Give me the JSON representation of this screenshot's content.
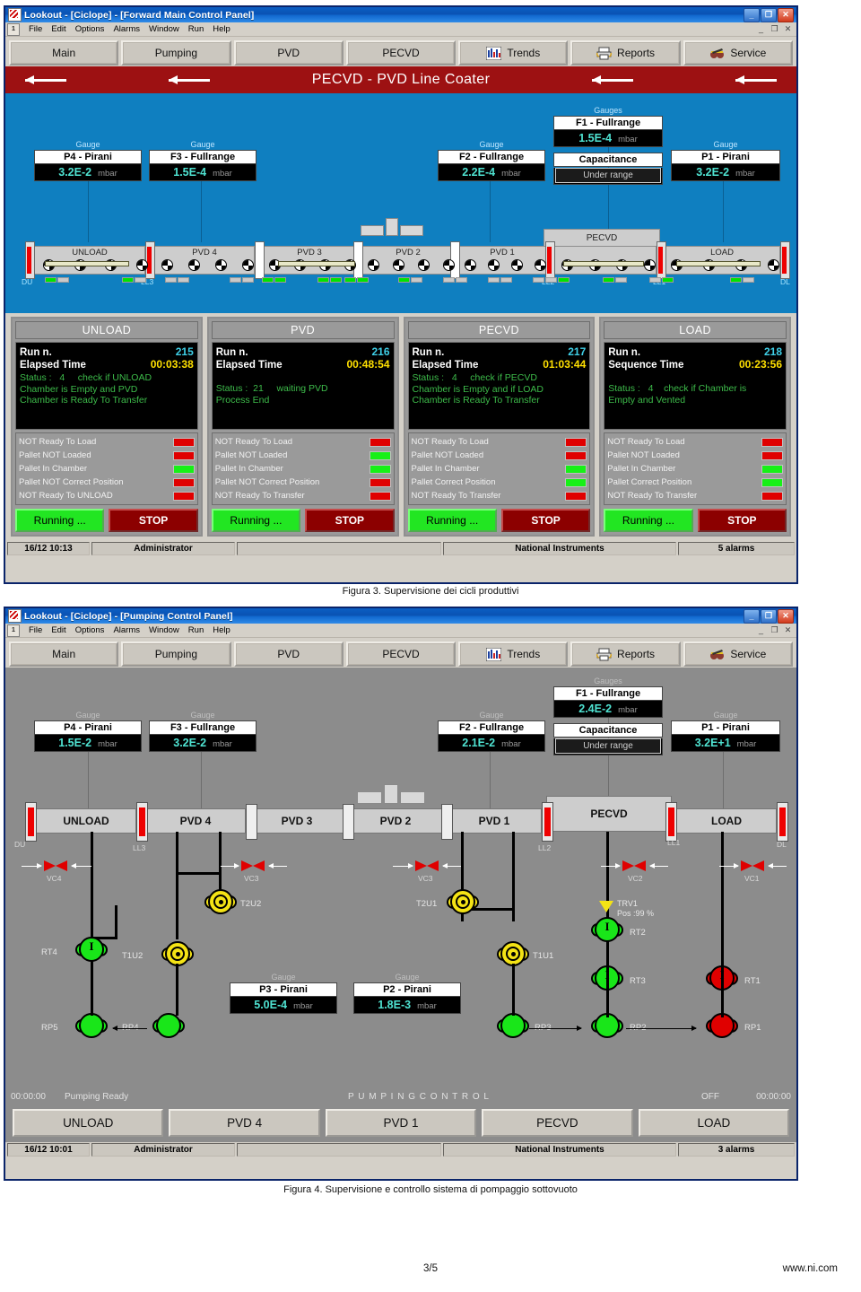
{
  "window1": {
    "title": "Lookout - [Ciclope] - [Forward Main Control Panel]",
    "menu": [
      "File",
      "Edit",
      "Options",
      "Alarms",
      "Window",
      "Run",
      "Help"
    ],
    "toolbar": [
      {
        "label": "Main",
        "icon": ""
      },
      {
        "label": "Pumping",
        "icon": ""
      },
      {
        "label": "PVD",
        "icon": ""
      },
      {
        "label": "PECVD",
        "icon": ""
      },
      {
        "label": "Trends",
        "icon": "bar-chart-icon"
      },
      {
        "label": "Reports",
        "icon": "printer-icon"
      },
      {
        "label": "Service",
        "icon": "tools-icon"
      }
    ],
    "banner": "PECVD - PVD  Line Coater",
    "gauges": [
      {
        "cap": "Gauge",
        "name": "P4 - Pirani",
        "value": "3.2E-2",
        "unit": "mbar"
      },
      {
        "cap": "Gauge",
        "name": "F3 - Fullrange",
        "value": "1.5E-4",
        "unit": "mbar"
      },
      {
        "cap": "Gauge",
        "name": "F2 - Fullrange",
        "value": "2.2E-4",
        "unit": "mbar"
      },
      {
        "cap": "Gauges",
        "name": "F1 - Fullrange",
        "value": "1.5E-4",
        "unit": "mbar"
      },
      {
        "cap": "",
        "name": "Capacitance",
        "value": "Under range",
        "unit": ""
      },
      {
        "cap": "Gauge",
        "name": "P1 - Pirani",
        "value": "3.2E-2",
        "unit": "mbar"
      }
    ],
    "chambers": [
      "UNLOAD",
      "PVD 4",
      "PVD 3",
      "PVD 2",
      "PVD 1",
      "PECVD",
      "LOAD"
    ],
    "gate_labels": [
      "DU",
      "LL3",
      "LL2",
      "LL1",
      "DL"
    ],
    "panels": [
      {
        "title": "UNLOAD",
        "k1": "Run n.",
        "v1": "215",
        "k2": "Elapsed Time",
        "v2": "00:03:38",
        "status": "Status :   4     check if UNLOAD\nChamber is Empty and PVD\nChamber is Ready To Transfer",
        "leds": [
          {
            "label": "NOT Ready To Load",
            "state": "red"
          },
          {
            "label": "Pallet NOT Loaded",
            "state": "red"
          },
          {
            "label": "Pallet In Chamber",
            "state": "green"
          },
          {
            "label": "Pallet NOT Correct Position",
            "state": "red"
          },
          {
            "label": "NOT Ready To UNLOAD",
            "state": "red"
          }
        ],
        "run_label": "Running ...",
        "stop_label": "STOP"
      },
      {
        "title": "PVD",
        "k1": "Run n.",
        "v1": "216",
        "k2": "Elapsed Time",
        "v2": "00:48:54",
        "status": "Status :  21     waiting PVD\nProcess End",
        "leds": [
          {
            "label": "NOT Ready To Load",
            "state": "red"
          },
          {
            "label": "Pallet NOT Loaded",
            "state": "green"
          },
          {
            "label": "Pallet In Chamber",
            "state": "green"
          },
          {
            "label": "Pallet NOT Correct Position",
            "state": "red"
          },
          {
            "label": "NOT Ready To Transfer",
            "state": "red"
          }
        ],
        "run_label": "Running ...",
        "stop_label": "STOP"
      },
      {
        "title": "PECVD",
        "k1": "Run n.",
        "v1": "217",
        "k2": "Elapsed Time",
        "v2": "01:03:44",
        "status": "Status :   4     check if PECVD\nChamber is Empty and if LOAD\nChamber is Ready To Transfer",
        "leds": [
          {
            "label": "NOT Ready To Load",
            "state": "red"
          },
          {
            "label": "Pallet NOT Loaded",
            "state": "red"
          },
          {
            "label": "Pallet In Chamber",
            "state": "green"
          },
          {
            "label": "Pallet Correct Position",
            "state": "green"
          },
          {
            "label": "NOT Ready To Transfer",
            "state": "red"
          }
        ],
        "run_label": "Running ...",
        "stop_label": "STOP"
      },
      {
        "title": "LOAD",
        "k1": "Run n.",
        "v1": "218",
        "k2": "Sequence Time",
        "v2": "00:23:56",
        "status": "Status :   4    check if Chamber is\nEmpty and Vented",
        "leds": [
          {
            "label": "NOT Ready To Load",
            "state": "red"
          },
          {
            "label": "Pallet NOT Loaded",
            "state": "red"
          },
          {
            "label": "Pallet In Chamber",
            "state": "green"
          },
          {
            "label": "Pallet Correct Position",
            "state": "green"
          },
          {
            "label": "NOT Ready To Transfer",
            "state": "red"
          }
        ],
        "run_label": "Running ...",
        "stop_label": "STOP"
      }
    ],
    "statusbar": {
      "time": "16/12 10:13",
      "user": "Administrator",
      "center": "",
      "brand": "National Instruments",
      "alarms": "5 alarms"
    }
  },
  "caption1": "Figura 3. Supervisione dei cicli produttivi",
  "window2": {
    "title": "Lookout - [Ciclope] - [Pumping Control Panel]",
    "menu": [
      "File",
      "Edit",
      "Options",
      "Alarms",
      "Window",
      "Run",
      "Help"
    ],
    "toolbar": [
      {
        "label": "Main",
        "icon": ""
      },
      {
        "label": "Pumping",
        "icon": ""
      },
      {
        "label": "PVD",
        "icon": ""
      },
      {
        "label": "PECVD",
        "icon": ""
      },
      {
        "label": "Trends",
        "icon": "bar-chart-icon"
      },
      {
        "label": "Reports",
        "icon": "printer-icon"
      },
      {
        "label": "Service",
        "icon": "tools-icon"
      }
    ],
    "gauges": [
      {
        "cap": "Gauge",
        "name": "P4 - Pirani",
        "value": "1.5E-2",
        "unit": "mbar"
      },
      {
        "cap": "Gauge",
        "name": "F3 - Fullrange",
        "value": "3.2E-2",
        "unit": "mbar"
      },
      {
        "cap": "Gauge",
        "name": "F2 - Fullrange",
        "value": "2.1E-2",
        "unit": "mbar"
      },
      {
        "cap": "Gauges",
        "name": "F1 - Fullrange",
        "value": "2.4E-2",
        "unit": "mbar"
      },
      {
        "cap": "",
        "name": "Capacitance",
        "value": "Under range",
        "unit": ""
      },
      {
        "cap": "Gauge",
        "name": "P1 - Pirani",
        "value": "3.2E+1",
        "unit": "mbar"
      },
      {
        "cap": "Gauge",
        "name": "P3 - Pirani",
        "value": "5.0E-4",
        "unit": "mbar"
      },
      {
        "cap": "Gauge",
        "name": "P2 - Pirani",
        "value": "1.8E-3",
        "unit": "mbar"
      }
    ],
    "chambers": [
      "UNLOAD",
      "PVD 4",
      "PVD 3",
      "PVD 2",
      "PVD 1",
      "PECVD",
      "LOAD"
    ],
    "gate_labels": [
      "DU",
      "LL3",
      "LL2",
      "LL1",
      "DL"
    ],
    "valves": [
      "VC4",
      "VC3",
      "VC3",
      "VC2",
      "VC1"
    ],
    "turbos": [
      {
        "name": "T2U2",
        "state": "yellow"
      },
      {
        "name": "T2U1",
        "state": "yellow"
      },
      {
        "name": "T1U2",
        "state": "yellow"
      },
      {
        "name": "T1U1",
        "state": "yellow"
      }
    ],
    "roots": [
      {
        "name": "RT4",
        "state": "green"
      },
      {
        "name": "RT2",
        "state": "green"
      },
      {
        "name": "RT3",
        "state": "green"
      },
      {
        "name": "RT1",
        "state": "red"
      }
    ],
    "pumps": [
      {
        "name": "RP5",
        "state": "green"
      },
      {
        "name": "RP4",
        "state": "green"
      },
      {
        "name": "RP3",
        "state": "green"
      },
      {
        "name": "RP2",
        "state": "green"
      },
      {
        "name": "RP1",
        "state": "red"
      }
    ],
    "trv": {
      "name": "TRV1",
      "pos": "Pos :99 %"
    },
    "bottom_status": {
      "left_time": "00:00:00",
      "left_text": "Pumping Ready",
      "center": "P U M P I N G    C O N T R O L",
      "right_state": "OFF",
      "right_time": "00:00:00"
    },
    "bigbuttons": [
      "UNLOAD",
      "PVD 4",
      "PVD 1",
      "PECVD",
      "LOAD"
    ],
    "statusbar": {
      "time": "16/12 10:01",
      "user": "Administrator",
      "center": "",
      "brand": "National Instruments",
      "alarms": "3 alarms"
    }
  },
  "caption2": "Figura 4. Supervisione e controllo sistema di pompaggio sottovuoto",
  "footer": {
    "page": "3/5",
    "site": "www.ni.com"
  }
}
